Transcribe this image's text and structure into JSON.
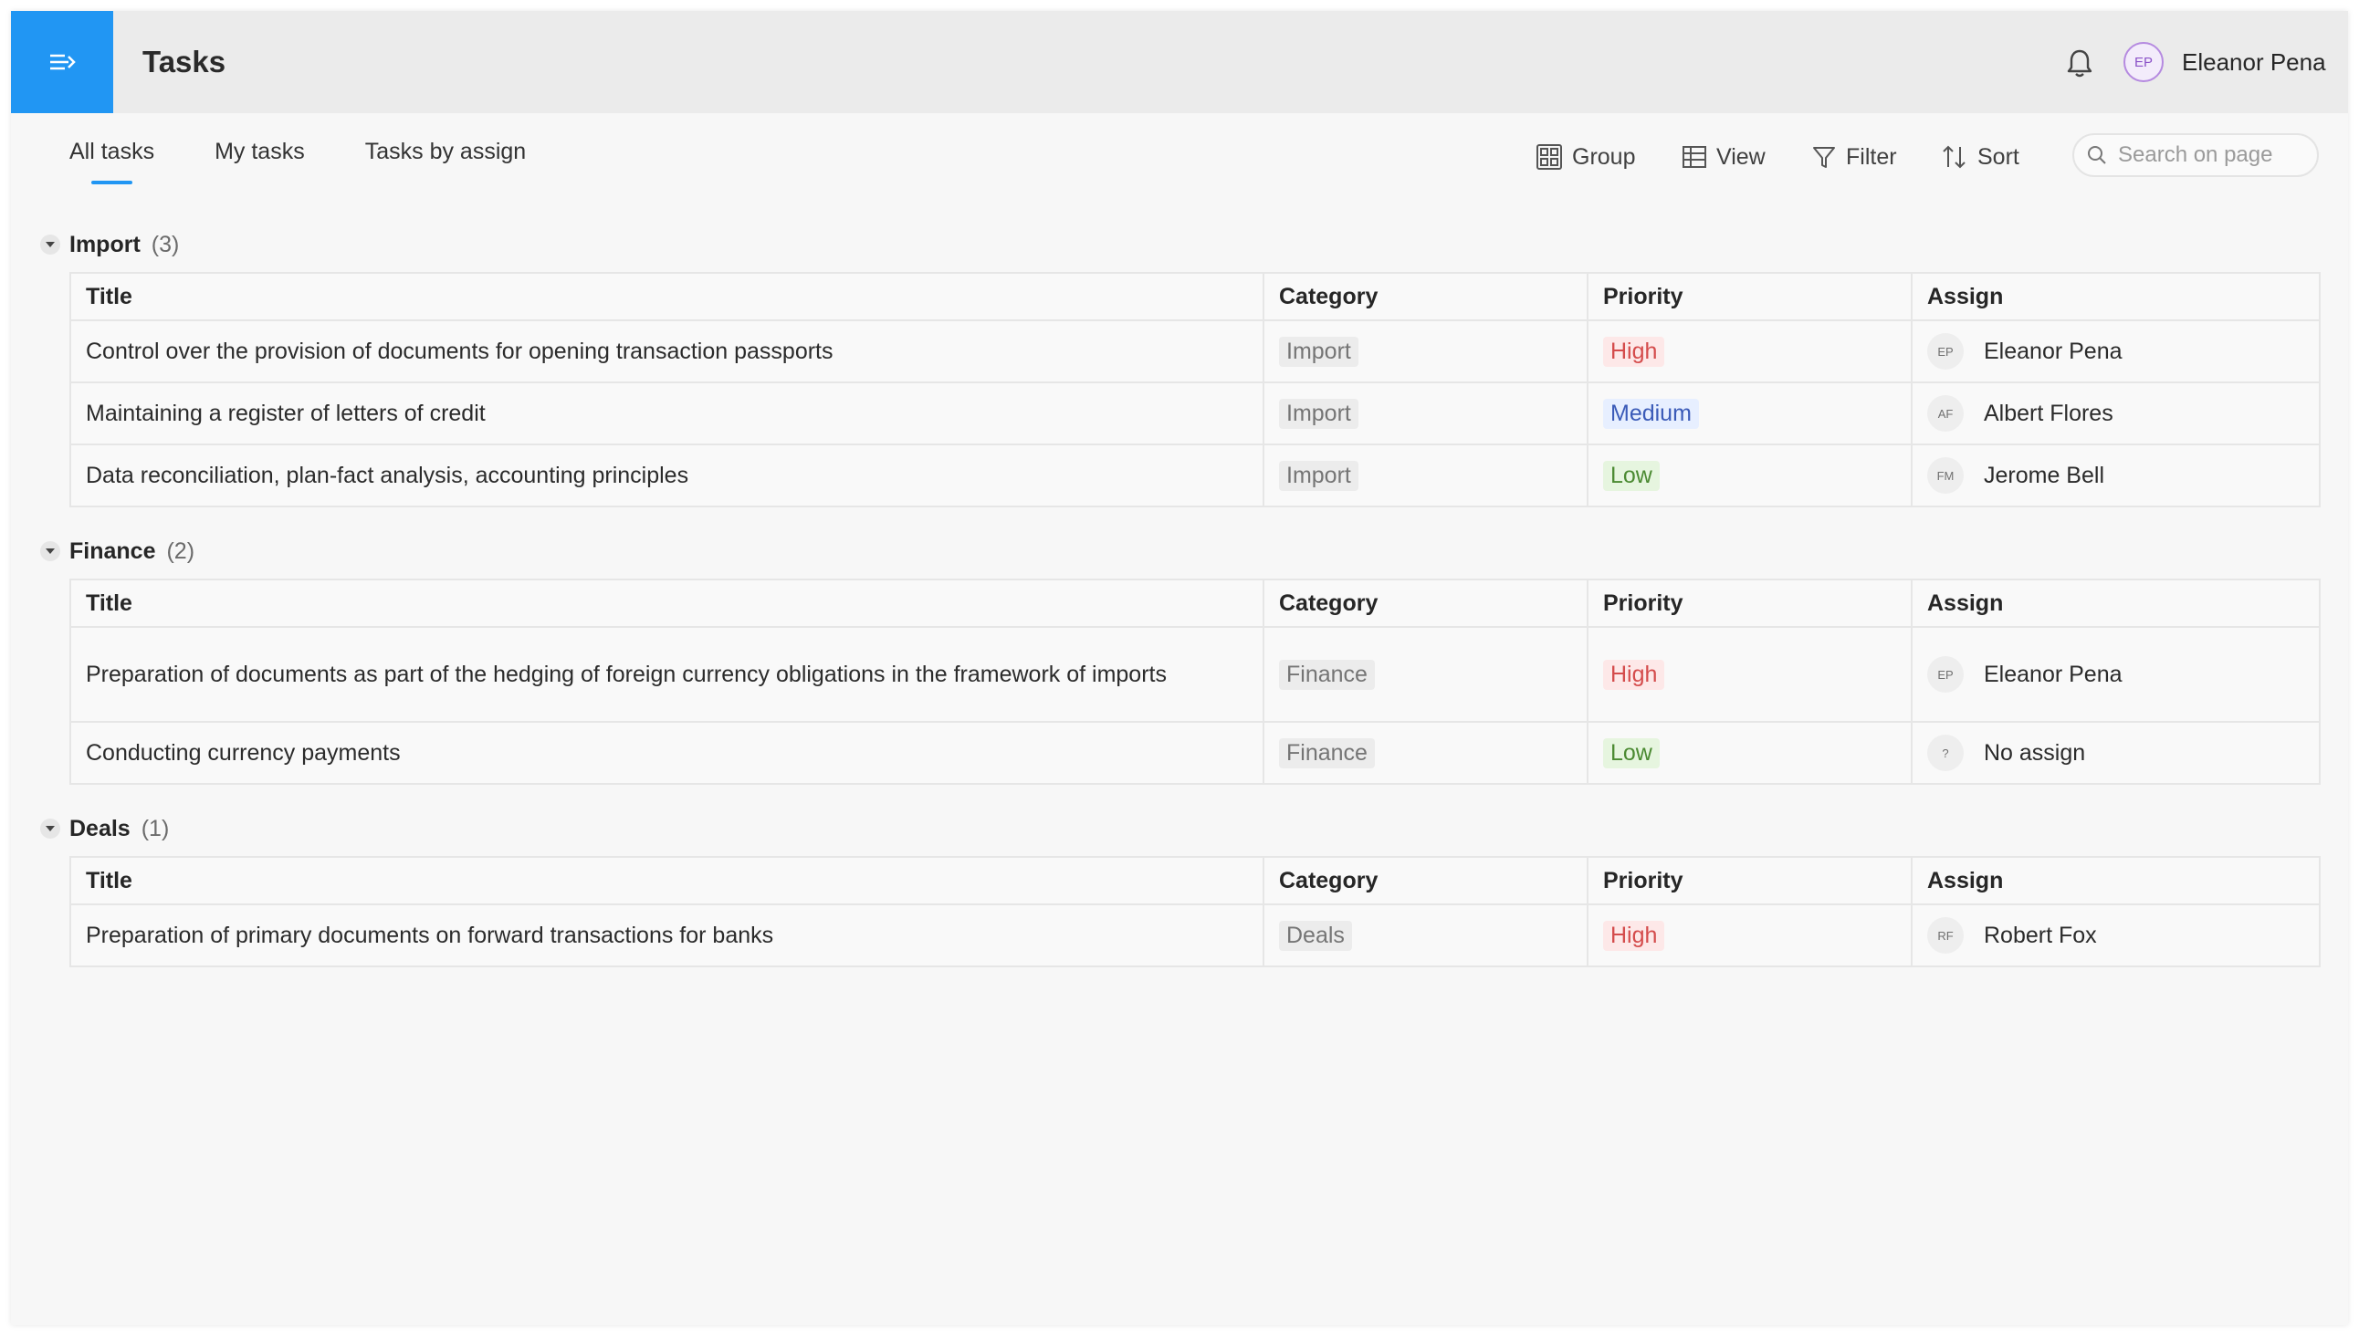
{
  "header": {
    "title": "Tasks",
    "user_name": "Eleanor Pena",
    "user_initials": "EP",
    "accent": "#2196f3"
  },
  "tabs": [
    {
      "label": "All tasks",
      "active": true
    },
    {
      "label": "My tasks",
      "active": false
    },
    {
      "label": "Tasks by assign",
      "active": false
    }
  ],
  "toolbar": {
    "group_label": "Group",
    "view_label": "View",
    "filter_label": "Filter",
    "sort_label": "Sort",
    "search_placeholder": "Search on page"
  },
  "columns": {
    "title": "Title",
    "category": "Category",
    "priority": "Priority",
    "assign": "Assign"
  },
  "groups": [
    {
      "name": "Import",
      "count": "(3)",
      "rows": [
        {
          "title": "Control over the provision of documents for opening transaction passports",
          "category": "Import",
          "priority": "High",
          "initials": "EP",
          "assignee": "Eleanor Pena"
        },
        {
          "title": "Maintaining a register of letters of credit",
          "category": "Import",
          "priority": "Medium",
          "initials": "AF",
          "assignee": "Albert Flores"
        },
        {
          "title": "Data reconciliation, plan-fact analysis, accounting principles",
          "category": "Import",
          "priority": "Low",
          "initials": "FM",
          "assignee": "Jerome Bell"
        }
      ]
    },
    {
      "name": "Finance",
      "count": "(2)",
      "rows": [
        {
          "title": "Preparation of documents as part of the hedging of foreign currency obligations in the framework of imports",
          "category": "Finance",
          "priority": "High",
          "initials": "EP",
          "assignee": "Eleanor Pena"
        },
        {
          "title": "Conducting currency payments",
          "category": "Finance",
          "priority": "Low",
          "initials": "?",
          "assignee": "No assign"
        }
      ]
    },
    {
      "name": "Deals",
      "count": "(1)",
      "rows": [
        {
          "title": "Preparation of primary documents on forward transactions for banks",
          "category": "Deals",
          "priority": "High",
          "initials": "RF",
          "assignee": "Robert Fox"
        }
      ]
    }
  ]
}
